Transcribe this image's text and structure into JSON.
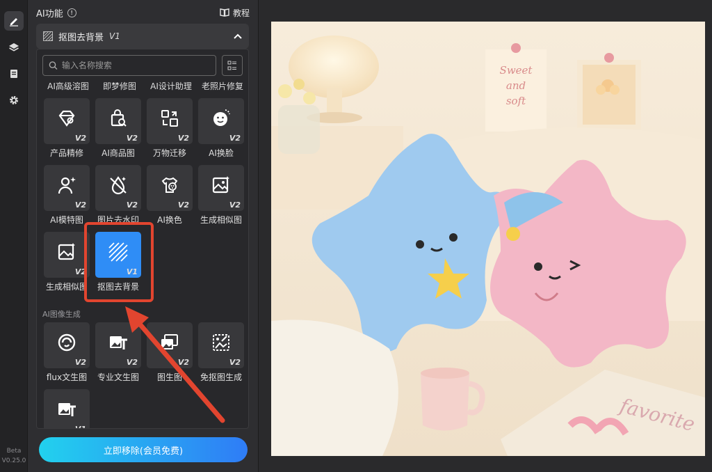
{
  "rail": {
    "beta": "Beta",
    "version": "V0.25.0"
  },
  "panel": {
    "title": "AI功能",
    "tutorial": "教程",
    "feature": {
      "name": "抠图去背景",
      "version": "V1"
    },
    "search": {
      "placeholder": "输入名称搜索"
    },
    "top_row": [
      "AI高级溶图",
      "即梦修图",
      "AI设计助理",
      "老照片修复"
    ],
    "tools": [
      {
        "label": "产品精修",
        "version": "V2",
        "icon": "diamond-sparkle-icon"
      },
      {
        "label": "AI商品图",
        "version": "V2",
        "icon": "shopping-bag-icon"
      },
      {
        "label": "万物迁移",
        "version": "V2",
        "icon": "transfer-icon"
      },
      {
        "label": "AI换脸",
        "version": "V2",
        "icon": "face-swap-icon"
      },
      {
        "label": "AI模特图",
        "version": "V2",
        "icon": "model-person-icon"
      },
      {
        "label": "图片去水印",
        "version": "V2",
        "icon": "watermark-remove-icon"
      },
      {
        "label": "AI换色",
        "version": "V2",
        "icon": "color-change-icon"
      },
      {
        "label": "生成相似图",
        "version": "V2",
        "icon": "similar-image-icon"
      },
      {
        "label": "生成相似图",
        "version": "V2",
        "icon": "similar-image-alt-icon"
      },
      {
        "label": "抠图去背景",
        "version": "V1",
        "icon": "background-remove-icon"
      }
    ],
    "section2_title": "AI图像生成",
    "gen_tools": [
      {
        "label": "flux文生图",
        "version": "V2",
        "icon": "flux-icon"
      },
      {
        "label": "专业文生图",
        "version": "V2",
        "icon": "text-to-image-icon"
      },
      {
        "label": "图生图",
        "version": "V2",
        "icon": "image-to-image-icon"
      },
      {
        "label": "免抠图生成",
        "version": "V2",
        "icon": "cutout-free-icon"
      },
      {
        "label": "",
        "version": "V1",
        "icon": "text-image-icon"
      }
    ],
    "remove_button": "立即移除(会员免费)"
  },
  "colors": {
    "accent": "#2f8df6",
    "highlight": "#e2452f",
    "arrow": "#e2452f"
  }
}
